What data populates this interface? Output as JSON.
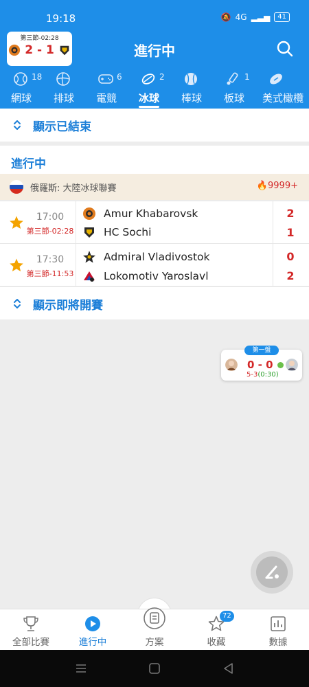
{
  "status_bar": {
    "time": "19:18",
    "network": "4G",
    "battery": "41"
  },
  "mini_card": {
    "period": "第三節-02:28",
    "score": "2 - 1"
  },
  "header": {
    "title": "進行中"
  },
  "sports_tabs": [
    {
      "label": "網球",
      "count": "18",
      "icon": "tennis-ball-icon"
    },
    {
      "label": "排球",
      "count": "",
      "icon": "volleyball-icon"
    },
    {
      "label": "電競",
      "count": "6",
      "icon": "gamepad-icon"
    },
    {
      "label": "冰球",
      "count": "2",
      "icon": "hockey-puck-icon",
      "active": true
    },
    {
      "label": "棒球",
      "count": "",
      "icon": "baseball-icon"
    },
    {
      "label": "板球",
      "count": "1",
      "icon": "cricket-bat-icon"
    },
    {
      "label": "美式橄欖",
      "count": "",
      "icon": "american-football-icon"
    }
  ],
  "toggle_finished": "顯示已結束",
  "section_live": "進行中",
  "league": {
    "name": "俄羅斯: 大陸冰球聯賽",
    "hot": "9999+"
  },
  "matches": [
    {
      "time": "17:00",
      "status": "第三節-02:28",
      "home": {
        "name": "Amur Khabarovsk",
        "score": "2"
      },
      "away": {
        "name": "HC Sochi",
        "score": "1"
      }
    },
    {
      "time": "17:30",
      "status": "第三節-11:53",
      "home": {
        "name": "Admiral Vladivostok",
        "score": "0"
      },
      "away": {
        "name": "Lokomotiv Yaroslavl",
        "score": "2"
      }
    }
  ],
  "toggle_upcoming": "顯示即將開賽",
  "floating_card": {
    "tag": "第一盤",
    "score": "0 - 0",
    "sub_main": "5-3",
    "sub_paren": "(0:30)"
  },
  "bottom_tabs": [
    {
      "label": "全部比賽",
      "icon": "trophy-icon"
    },
    {
      "label": "進行中",
      "icon": "play-circle-icon",
      "active": true
    },
    {
      "label": "方案",
      "icon": "document-icon"
    },
    {
      "label": "收藏",
      "icon": "star-outline-icon",
      "badge": "72"
    },
    {
      "label": "數據",
      "icon": "bar-chart-icon"
    }
  ],
  "colors": {
    "brand": "#1e8ee8",
    "accent_text": "#1c7fd8",
    "live_red": "#d32828",
    "league_bg": "#f5ede0"
  }
}
